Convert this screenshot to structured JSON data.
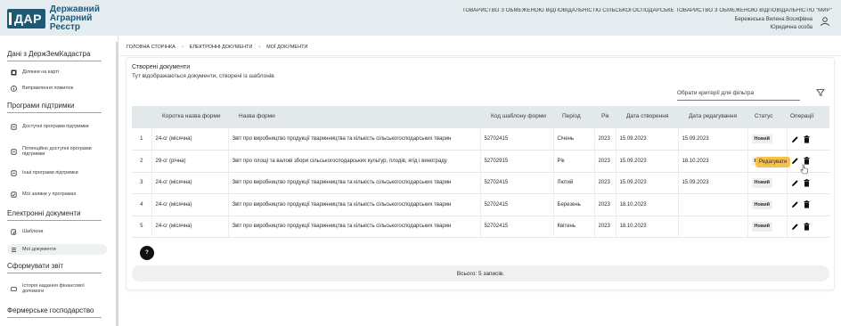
{
  "header": {
    "logo_abbr": "ДАР",
    "logo_line1": "Державний",
    "logo_line2": "Аграрний",
    "logo_line3": "Реєстр",
    "organization": "ТОВАРИСТВО З ОБМЕЖЕНОЮ ВІДПОВІДАЛЬНІСТЮ СІЛЬСЬКОГОСПОДАРСЬКЕ ТОВАРИСТВО З ОБМЕЖЕНОЮ ВІДПОВІДАЛЬНІСТЮ \"МИР\"",
    "user_name": "Бережнська Вилена Восифівна",
    "user_role": "Юридична особа"
  },
  "sidebar": {
    "cut_label": "",
    "sections": {
      "dzk": "Дані з ДержЗемКадастра",
      "support": "Програми підтримки",
      "edocs": "Електронні документи",
      "report": "Сформувати звіт",
      "farm": "Фермерське господарство"
    },
    "items": {
      "plots_on_map": "Ділянки на карті",
      "fix_errors": "Виправлення помилок",
      "available_programs": "Доступні програми підтримки",
      "potential_programs": "Потенційно доступні програми підтримки",
      "other_programs": "Інші програми підтримки",
      "my_applications": "Мої заявки у програмах",
      "templates": "Шаблони",
      "my_documents": "Мої документи",
      "financial_help_history": "Історія надання фінансової допомоги"
    }
  },
  "breadcrumb": {
    "home": "ГОЛОВНА СТОРІНКА",
    "edocs": "ЕЛЕКТРОННІ ДОКУМЕНТИ",
    "my_docs": "МОЇ ДОКУМЕНТИ",
    "separator": "›"
  },
  "main": {
    "title": "Створені документи",
    "subtitle": "Тут відображаються документи, створені із шаблонів",
    "filter_placeholder": "Обрати критерії для фільтра",
    "columns": {
      "short_name": "Коротка назва форми",
      "form_name": "Назва форми",
      "template_code": "Код шаблону форми",
      "period": "Період",
      "year": "Рік",
      "created": "Дата створення",
      "edited": "Дата редагування",
      "status": "Статус",
      "operations": "Операції"
    },
    "rows": [
      {
        "n": "1",
        "short": "24-сг (місячна)",
        "name": "Звіт про виробництво продукції тваринництва та кількість сільськогосподарських тварин",
        "code": "52702415",
        "period": "Січень",
        "year": "2023",
        "created": "15.09.2023",
        "edited": "15.09.2023",
        "status": "Новий"
      },
      {
        "n": "2",
        "short": "29-сг (річна)",
        "name": "Звіт про площі та валові збори сільськогосподарських культур, плодів, ягід і винограду",
        "code": "52702915",
        "period": "Рік",
        "year": "2023",
        "created": "15.09.2023",
        "edited": "18.10.2023",
        "status": "Новий"
      },
      {
        "n": "3",
        "short": "24-сг (місячна)",
        "name": "Звіт про виробництво продукції тваринництва та кількість сільськогосподарських тварин",
        "code": "52702415",
        "period": "Лютий",
        "year": "2023",
        "created": "15.09.2023",
        "edited": "15.09.2023",
        "status": "Новий"
      },
      {
        "n": "4",
        "short": "24-сг (місячна)",
        "name": "Звіт про виробництво продукції тваринництва та кількість сільськогосподарських тварин",
        "code": "52702415",
        "period": "Березень",
        "year": "2023",
        "created": "18.10.2023",
        "edited": "",
        "status": "Новий"
      },
      {
        "n": "5",
        "short": "24-сг (місячна)",
        "name": "Звіт про виробництво продукції тваринництва та кількість сільськогосподарських тварин",
        "code": "52702415",
        "period": "Квітень",
        "year": "2023",
        "created": "18.10.2023",
        "edited": "",
        "status": "Новий"
      }
    ],
    "tooltip": "Редагувати",
    "help_label": "?",
    "total": "Всього: 5 записів."
  },
  "colors": {
    "brand": "#1f5873",
    "header_bg": "#e4ecef",
    "table_header_bg": "#e3e8ea",
    "tooltip_bg": "#f7c24a"
  }
}
